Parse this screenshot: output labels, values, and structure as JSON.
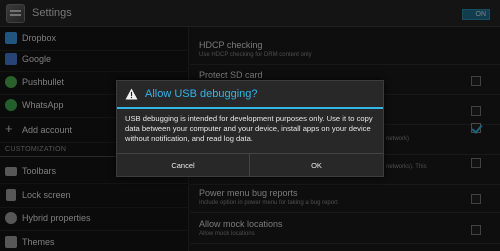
{
  "action_bar": {
    "title": "Settings",
    "toggle": "ON"
  },
  "sidebar": {
    "items_top": [
      {
        "label": "Dropbox",
        "icon": "dropbox-icon",
        "color": "#3d9ae8"
      },
      {
        "label": "Google",
        "icon": "google-icon",
        "color": "#4a7cd9"
      },
      {
        "label": "Pushbullet",
        "icon": "pushbullet-icon",
        "color": "#4caf50"
      },
      {
        "label": "WhatsApp",
        "icon": "whatsapp-icon",
        "color": "#3fae50"
      },
      {
        "label": "Add account",
        "icon": "plus-icon",
        "color": "#bdbdbd"
      }
    ],
    "section_header": "CUSTOMIZATION",
    "items_bottom": [
      {
        "label": "Toolbars",
        "icon": "toolbars-icon",
        "color": "#9e9e9e"
      },
      {
        "label": "Lock screen",
        "icon": "lock-icon",
        "color": "#9e9e9e"
      },
      {
        "label": "Hybrid properties",
        "icon": "hybrid-icon",
        "color": "#9e9e9e"
      },
      {
        "label": "Themes",
        "icon": "themes-icon",
        "color": "#9e9e9e"
      }
    ]
  },
  "content": {
    "prefs": [
      {
        "title": "HDCP checking",
        "summary": "Use HDCP checking for DRM content only",
        "checkbox": null
      },
      {
        "title": "Protect SD card",
        "summary": "",
        "checkbox": false
      },
      {
        "title": "",
        "summary": "",
        "checkbox": false
      },
      {
        "title": "",
        "summary": "network)",
        "checkbox": true
      },
      {
        "title": "",
        "summary": "networks). This",
        "checkbox": false
      },
      {
        "title": "",
        "summary": "",
        "checkbox": false
      },
      {
        "title": "Power menu bug reports",
        "summary": "Include option in power menu for taking a bug report",
        "checkbox": false
      },
      {
        "title": "Allow mock locations",
        "summary": "Allow mock locations",
        "checkbox": false
      }
    ]
  },
  "dialog": {
    "title": "Allow USB debugging?",
    "message": "USB debugging is intended for development purposes only. Use it to copy data between your computer and your device, install apps on your device without notification, and read log data.",
    "cancel_label": "Cancel",
    "ok_label": "OK",
    "accent_color": "#33b5e5"
  }
}
